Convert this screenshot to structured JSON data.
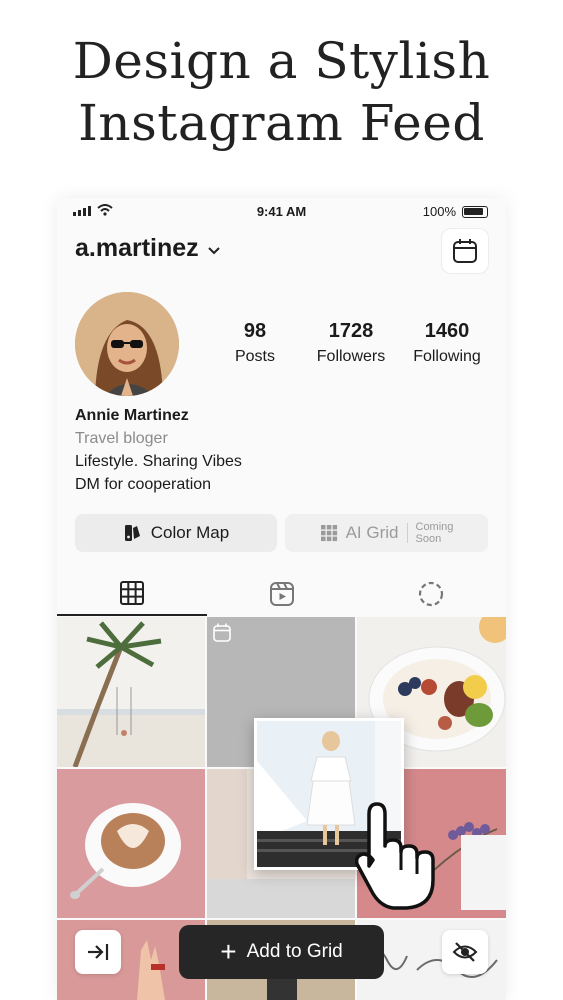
{
  "headline": {
    "line1": "Design a Stylish",
    "line2": "Instagram Feed"
  },
  "status_bar": {
    "time": "9:41 AM",
    "battery": "100%"
  },
  "profile": {
    "username": "a.martinez",
    "stats": [
      {
        "value": "98",
        "label": "Posts"
      },
      {
        "value": "1728",
        "label": "Followers"
      },
      {
        "value": "1460",
        "label": "Following"
      }
    ],
    "name": "Annie Martinez",
    "category": "Travel bloger",
    "bio_line1": "Lifestyle. Sharing Vibes",
    "bio_line2": "DM for cooperation"
  },
  "buttons": {
    "color_map": "Color Map",
    "ai_grid": "AI Grid",
    "coming_soon_1": "Coming",
    "coming_soon_2": "Soon",
    "add_to_grid": "Add to Grid"
  },
  "tabs": [
    "grid-icon",
    "reels-icon",
    "loading-circle-icon"
  ],
  "icons": [
    "calendar-icon",
    "chevron-down-icon",
    "palette-icon",
    "grid-dots-icon",
    "hand-pointer-icon",
    "collapse-arrow-icon",
    "eye-off-icon"
  ],
  "colors": {
    "accent_dark": "#262626",
    "button_bg": "#ececec",
    "muted_text": "#8b8b8b"
  }
}
